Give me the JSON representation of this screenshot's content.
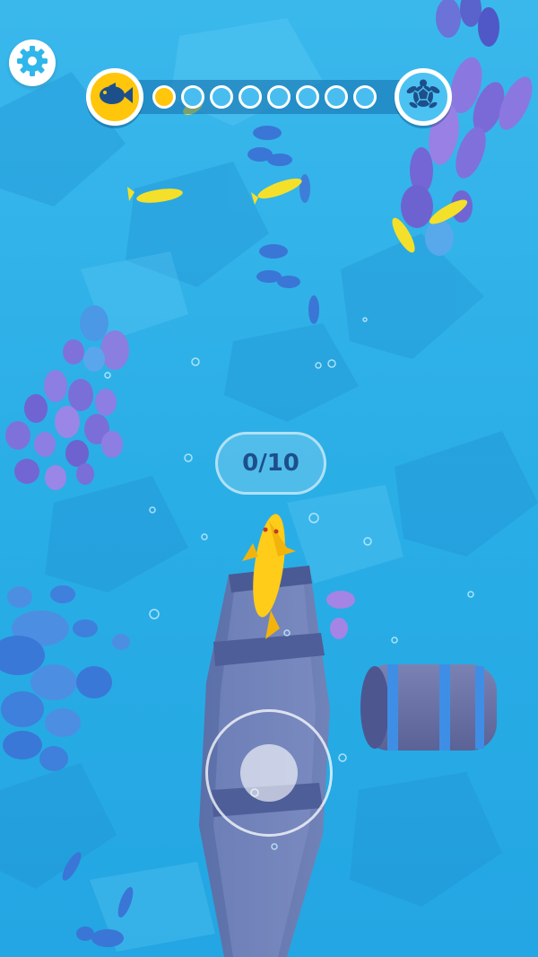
{
  "hud": {
    "counter_text": "0/10",
    "progress": {
      "filled": 1,
      "total": 8
    },
    "start_icon": "fish-icon",
    "end_icon": "turtle-icon",
    "settings_icon": "gear-icon"
  },
  "colors": {
    "water": "#2fb6ea",
    "player_fish": "#ffcc1a",
    "progress_gold": "#ffc60b",
    "counter_text": "#1d4f8a"
  }
}
